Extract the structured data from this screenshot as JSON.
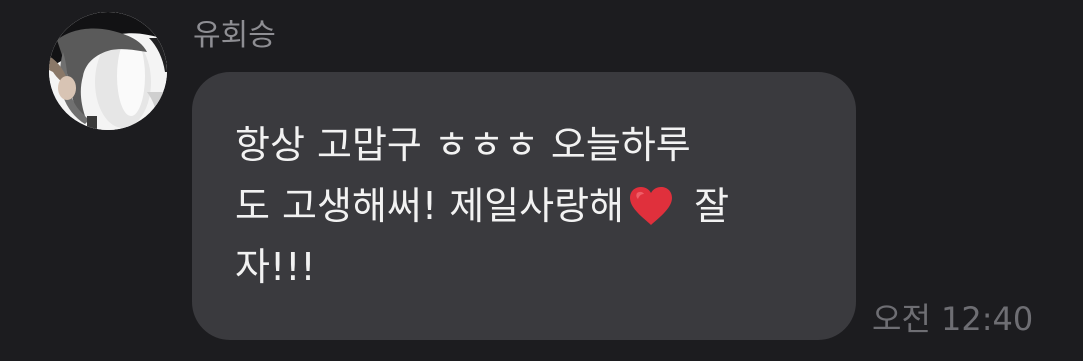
{
  "message": {
    "sender_name": "유회승",
    "text_before_emoji": "항상 고맙구 ㅎㅎㅎ 오늘하루\n도 고생해써! 제일사랑해",
    "emoji": "heart-icon",
    "text_after_emoji": " 잘\n자!!!",
    "time": "오전 12:40"
  },
  "colors": {
    "background": "#1c1c1f",
    "bubble": "#3a3a3e",
    "text": "#f2f2f2",
    "sender_name": "#8e8e93",
    "timestamp": "#6e6e73",
    "heart": "#e0303c"
  }
}
